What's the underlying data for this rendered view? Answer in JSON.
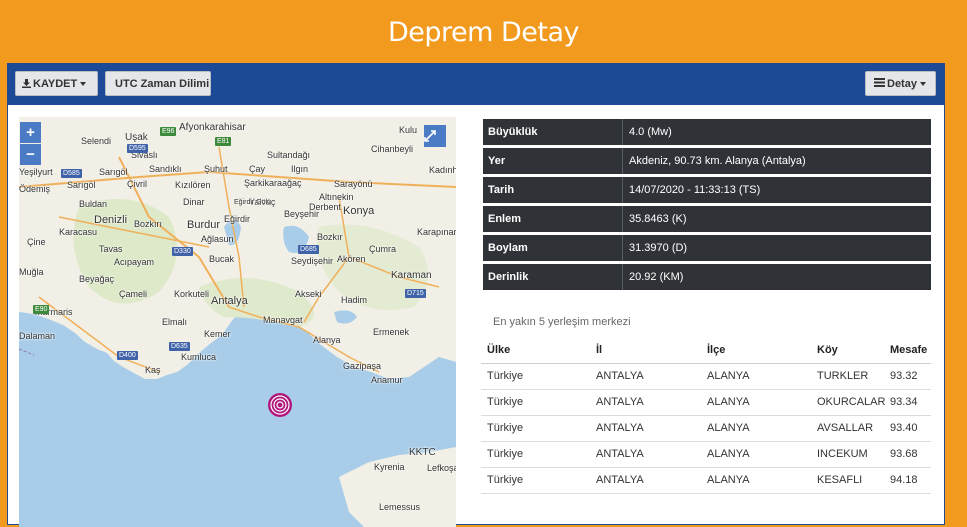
{
  "header": {
    "title": "Deprem Detay"
  },
  "toolbar": {
    "save_label": "KAYDET",
    "utc_label": "UTC Zaman Dilimi",
    "detail_label": "Detay"
  },
  "colors": {
    "header_bg": "#f29a1e",
    "toolbar_bg": "#1c4a96",
    "info_row_bg": "#2f3338",
    "epicenter": "#b0177d"
  },
  "map": {
    "zoom_in": "+",
    "zoom_out": "−",
    "labels": [
      "Uşak",
      "Selendi",
      "Sivaslı",
      "Afyonkarahisar",
      "Sultandağı",
      "Kulu",
      "Cihanbeyli",
      "Sarıgöl",
      "Yeşilyurt",
      "Sandıklı",
      "Şuhut",
      "Çay",
      "Ilgın",
      "Kadınhanı",
      "Ödemiş",
      "Sarıgöl",
      "Çivril",
      "Kızılören",
      "Şarkikaraağaç",
      "Sarayönü",
      "Altınekin",
      "Karapınar",
      "Buldan",
      "Denizli",
      "Dinar",
      "Eğirdir",
      "Yalvaç",
      "Derbent",
      "Konya",
      "Beyşehir",
      "Bozkırı",
      "Çine",
      "Karacasu",
      "Burdur",
      "Ağlasun",
      "Eğirdir Gölü",
      "Bozkır",
      "Çumra",
      "Tavas",
      "Acıpayam",
      "Bucak",
      "Seydişehir",
      "Akören",
      "Karaman",
      "Muğla",
      "Beyağaç",
      "Çameli",
      "Korkuteli",
      "Antalya",
      "Hadim",
      "Akseki",
      "Marmaris",
      "Elmalı",
      "Manavgat",
      "Ermenek",
      "Kemer",
      "Alanya",
      "Kumluca",
      "Gazipaşa",
      "Anamur",
      "Kaş",
      "KKTC",
      "Kyrenia",
      "Lefkoşa",
      "Lemessus",
      "Dalaman"
    ],
    "shields": [
      "E96",
      "D585",
      "D595",
      "E81",
      "D330",
      "D685",
      "D635",
      "D400",
      "D715",
      "E90"
    ]
  },
  "info": [
    {
      "label": "Büyüklük",
      "value": "4.0 (Mw)"
    },
    {
      "label": "Yer",
      "value": "Akdeniz, 90.73 km. Alanya (Antalya)"
    },
    {
      "label": "Tarih",
      "value": "14/07/2020 - 11:33:13 (TS)"
    },
    {
      "label": "Enlem",
      "value": "35.8463 (K)"
    },
    {
      "label": "Boylam",
      "value": "31.3970 (D)"
    },
    {
      "label": "Derinlik",
      "value": "20.92 (KM)"
    }
  ],
  "nearest": {
    "title": "En yakın 5 yerleşim merkezi",
    "headers": [
      "Ülke",
      "İl",
      "İlçe",
      "Köy",
      "Mesafe"
    ],
    "rows": [
      [
        "Türkiye",
        "ANTALYA",
        "ALANYA",
        "TURKLER",
        "93.32"
      ],
      [
        "Türkiye",
        "ANTALYA",
        "ALANYA",
        "OKURCALAR",
        "93.34"
      ],
      [
        "Türkiye",
        "ANTALYA",
        "ALANYA",
        "AVSALLAR",
        "93.40"
      ],
      [
        "Türkiye",
        "ANTALYA",
        "ALANYA",
        "INCEKUM",
        "93.68"
      ],
      [
        "Türkiye",
        "ANTALYA",
        "ALANYA",
        "KESAFLI",
        "94.18"
      ]
    ]
  }
}
